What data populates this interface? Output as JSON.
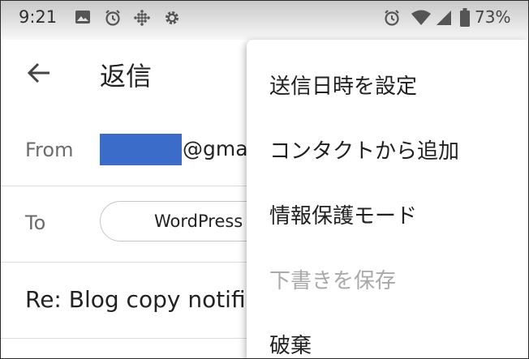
{
  "status_bar": {
    "time": "9:21",
    "battery_percent": "73%",
    "icons": [
      "image-icon",
      "alarm-icon",
      "grid-dots-icon",
      "settings-gear-icon",
      "alarm-icon",
      "wifi-icon",
      "signal-icon",
      "battery-icon"
    ]
  },
  "app_bar": {
    "title": "返信",
    "back_icon": "arrow-left-icon"
  },
  "compose": {
    "from_label": "From",
    "from_value_visible": "@gma",
    "to_label": "To",
    "to_chip": "WordPress",
    "subject": "Re: Blog copy notific"
  },
  "menu": {
    "items": [
      {
        "label": "送信日時を設定",
        "enabled": true
      },
      {
        "label": "コンタクトから追加",
        "enabled": true
      },
      {
        "label": "情報保護モード",
        "enabled": true
      },
      {
        "label": "下書きを保存",
        "enabled": false
      },
      {
        "label": "破棄",
        "enabled": true
      }
    ]
  },
  "colors": {
    "redaction": "#3b6cc9",
    "disabled_text": "#a9a9a9",
    "status_bar_top": "#c9c9c9"
  }
}
